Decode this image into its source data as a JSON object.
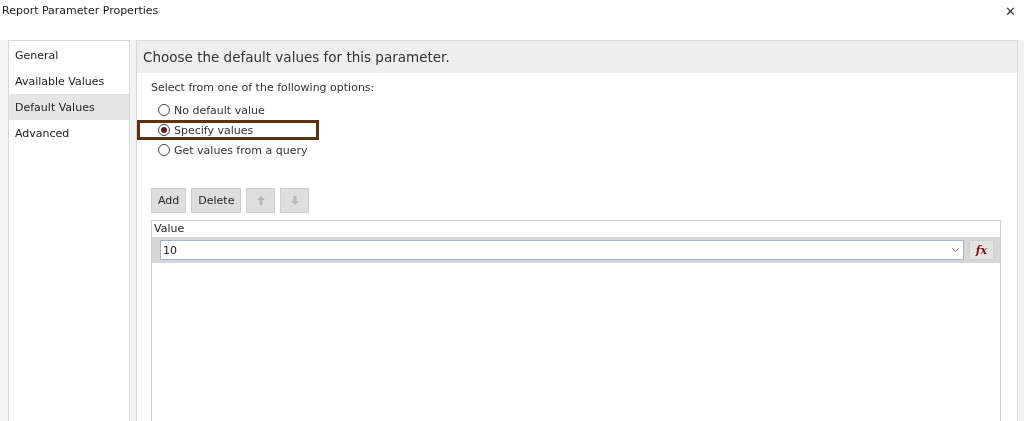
{
  "window": {
    "title": "Report Parameter Properties",
    "close": "✕"
  },
  "sidebar": {
    "items": [
      {
        "label": "General",
        "selected": false
      },
      {
        "label": "Available Values",
        "selected": false
      },
      {
        "label": "Default Values",
        "selected": true
      },
      {
        "label": "Advanced",
        "selected": false
      }
    ]
  },
  "header": "Choose the default values for this parameter.",
  "options_prompt": "Select from one of the following options:",
  "options": [
    {
      "label": "No default value",
      "selected": false,
      "highlighted": false
    },
    {
      "label": "Specify values",
      "selected": true,
      "highlighted": true
    },
    {
      "label": "Get values from a query",
      "selected": false,
      "highlighted": false
    }
  ],
  "toolbar": [
    {
      "kind": "text",
      "label": "Add",
      "disabled": false
    },
    {
      "kind": "text",
      "label": "Delete",
      "disabled": false
    },
    {
      "kind": "up",
      "disabled": true
    },
    {
      "kind": "down",
      "disabled": true
    }
  ],
  "grid": {
    "column": "Value",
    "rows": [
      {
        "value": "10",
        "expression_button": "fx"
      }
    ]
  }
}
